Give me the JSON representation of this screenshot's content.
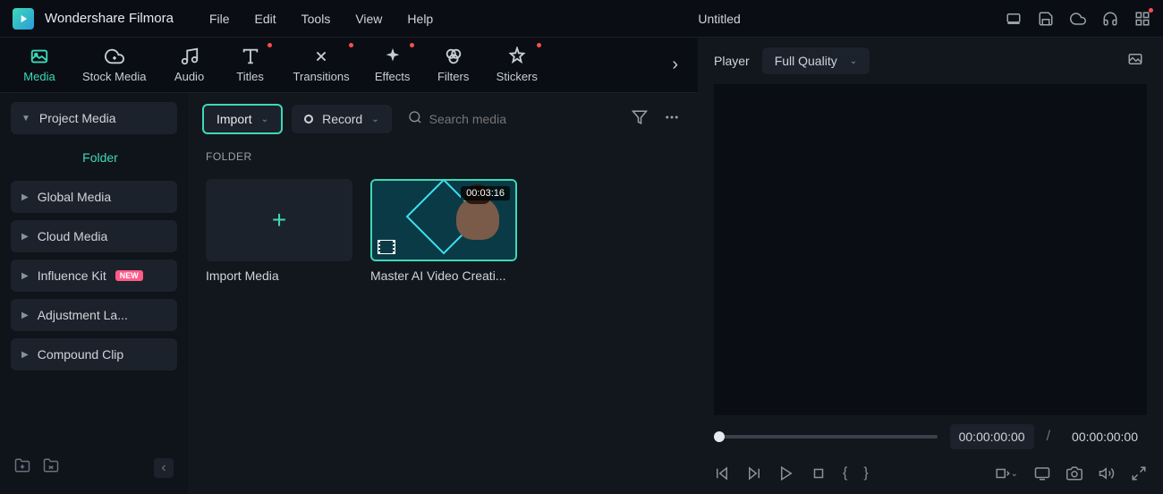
{
  "brand": "Wondershare Filmora",
  "menu": {
    "items": [
      "File",
      "Edit",
      "Tools",
      "View",
      "Help"
    ]
  },
  "project_title": "Untitled",
  "tabs": [
    {
      "label": "Media",
      "active": true,
      "dot": false
    },
    {
      "label": "Stock Media",
      "active": false,
      "dot": false
    },
    {
      "label": "Audio",
      "active": false,
      "dot": false
    },
    {
      "label": "Titles",
      "active": false,
      "dot": true
    },
    {
      "label": "Transitions",
      "active": false,
      "dot": true
    },
    {
      "label": "Effects",
      "active": false,
      "dot": true
    },
    {
      "label": "Filters",
      "active": false,
      "dot": false
    },
    {
      "label": "Stickers",
      "active": false,
      "dot": true
    }
  ],
  "sidebar": {
    "project_media": "Project Media",
    "folder": "Folder",
    "global_media": "Global Media",
    "cloud_media": "Cloud Media",
    "influence_kit": "Influence Kit",
    "influence_badge": "NEW",
    "adjustment": "Adjustment La...",
    "compound": "Compound Clip"
  },
  "toolbar": {
    "import": "Import",
    "record": "Record",
    "search_placeholder": "Search media"
  },
  "folder_label": "FOLDER",
  "media": {
    "import_label": "Import Media",
    "clip_name": "Master AI Video Creati...",
    "clip_duration": "00:03:16"
  },
  "player": {
    "label": "Player",
    "quality": "Full Quality",
    "current": "00:00:00:00",
    "total": "00:00:00:00"
  }
}
